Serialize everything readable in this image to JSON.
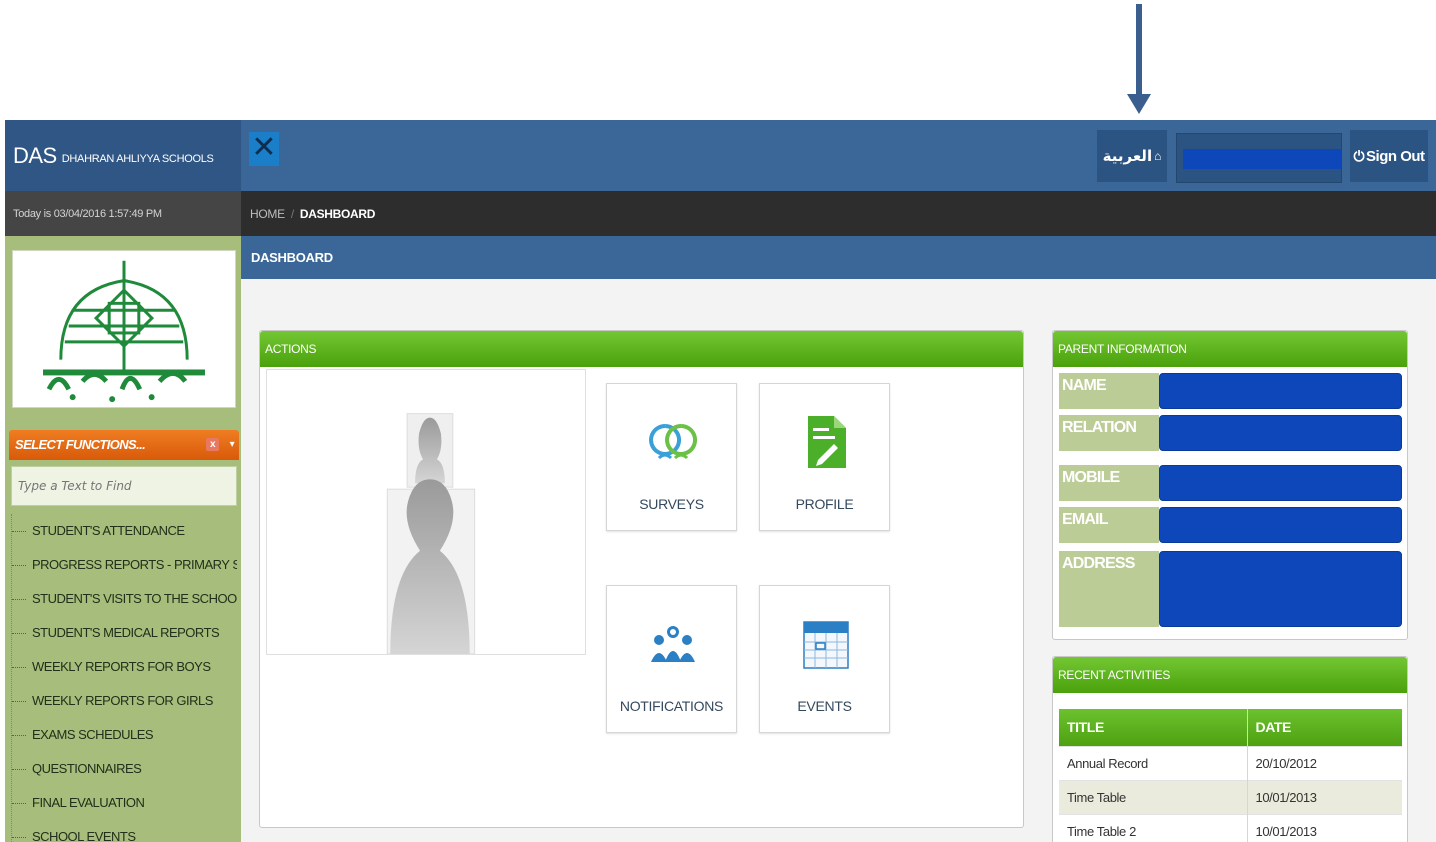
{
  "header": {
    "brand_short": "DAS",
    "brand_full": "DHAHRAN AHLIYYA SCHOOLS",
    "language_button": "العربية",
    "signout_label": "Sign Out"
  },
  "status": {
    "today": "Today is 03/04/2016 1:57:49 PM"
  },
  "breadcrumb": {
    "home": "HOME",
    "separator": "/",
    "current": "DASHBOARD"
  },
  "sidebar": {
    "functions_title": "SELECT FUNCTIONS...",
    "close_glyph": "x",
    "search_placeholder": "Type a Text to Find",
    "items": [
      "STUDENT'S ATTENDANCE",
      "PROGRESS REPORTS - PRIMARY STAGE",
      "STUDENT'S VISITS TO THE SCHOOL'S NURSE",
      "STUDENT'S MEDICAL REPORTS",
      "WEEKLY REPORTS FOR BOYS",
      "WEEKLY REPORTS FOR GIRLS",
      "EXAMS SCHEDULES",
      "QUESTIONNAIRES",
      "FINAL EVALUATION",
      "SCHOOL EVENTS"
    ]
  },
  "page": {
    "title": "DASHBOARD"
  },
  "actions": {
    "title": "ACTIONS",
    "tiles": [
      {
        "label": "SURVEYS",
        "icon": "surveys-icon"
      },
      {
        "label": "PROFILE",
        "icon": "profile-document-icon"
      },
      {
        "label": "NOTIFICATIONS",
        "icon": "notifications-people-icon"
      },
      {
        "label": "EVENTS",
        "icon": "calendar-icon"
      }
    ]
  },
  "parent_info": {
    "title": "PARENT INFORMATION",
    "fields": [
      "NAME",
      "RELATION",
      "MOBILE",
      "EMAIL",
      "ADDRESS"
    ]
  },
  "recent_activities": {
    "title": "RECENT ACTIVITIES",
    "columns": [
      "TITLE",
      "DATE"
    ],
    "rows": [
      [
        "Annual Record",
        "20/10/2012"
      ],
      [
        "Time Table",
        "10/01/2013"
      ],
      [
        "Time Table 2",
        "10/01/2013"
      ]
    ]
  },
  "colors": {
    "header_blue": "#3b6798",
    "sidebar_green": "#a6bd7b",
    "panel_green": "#5db21d",
    "functions_orange": "#e8700f",
    "redaction_blue": "#0d47b9"
  }
}
